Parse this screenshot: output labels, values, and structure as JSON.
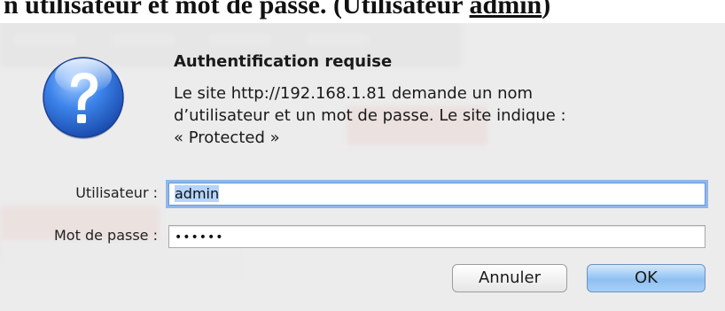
{
  "heading": {
    "prefix": "n utilisateur et mot de passe.",
    "suffix": " (Utilisateur ",
    "username_link": "admin",
    "close": ")"
  },
  "dialog": {
    "title": "Authentification requise",
    "message_lines": [
      "Le site http://192.168.1.81 demande un nom",
      "d’utilisateur et un mot de passe. Le site indique :",
      "« Protected »"
    ],
    "icon": "question-mark-icon",
    "username_label": "Utilisateur :",
    "username_value": "admin",
    "password_label": "Mot de passe :",
    "password_value": "••••••",
    "cancel_label": "Annuler",
    "ok_label": "OK"
  },
  "colors": {
    "icon_blue": "#2f6fd6",
    "default_button": "#8ec0f2",
    "focus_ring": "#8fb7ec"
  }
}
